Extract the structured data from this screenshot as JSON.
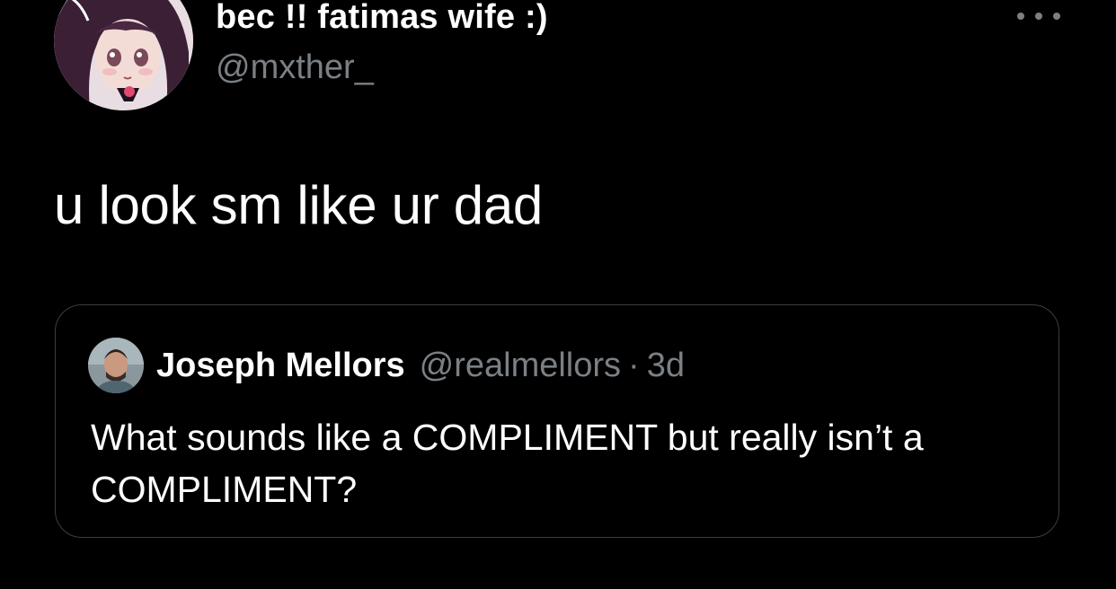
{
  "tweet": {
    "author": {
      "display_name": "bec !! fatimas wife :)",
      "handle": "@mxther_",
      "avatar_icon": "anime-avatar"
    },
    "more_icon": "more-horizontal-icon",
    "text": "u look sm like ur dad"
  },
  "quoted_tweet": {
    "author": {
      "display_name": "Joseph Mellors",
      "handle": "@realmellors",
      "avatar_icon": "user-photo-avatar"
    },
    "separator": "·",
    "time": "3d",
    "text": "What sounds like a COMPLIMENT but really isn’t a COMPLIMENT?"
  },
  "colors": {
    "background": "#000000",
    "text_primary": "#ffffff",
    "text_secondary": "#7b8085",
    "card_border": "#3a3d40"
  }
}
